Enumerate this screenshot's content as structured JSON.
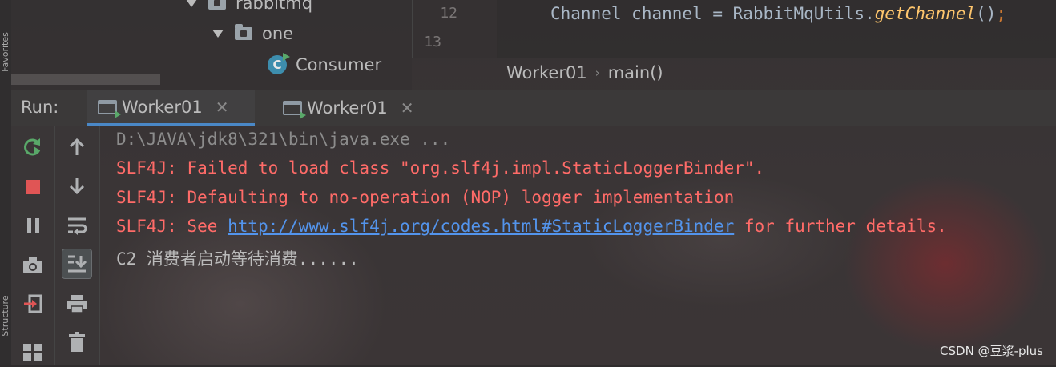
{
  "sidebar_edge": {
    "top_label": "Favorites",
    "bottom_label": "Structure"
  },
  "project_tree": {
    "items": [
      {
        "label": "rabbitmq",
        "type": "folder"
      },
      {
        "label": "one",
        "type": "folder"
      },
      {
        "label": "Consumer",
        "type": "class",
        "icon_letter": "C"
      }
    ]
  },
  "editor": {
    "line_numbers": [
      "12",
      "13"
    ],
    "code_line": {
      "type": "Channel",
      "var": "channel",
      "op": "=",
      "class": "RabbitMqUtils",
      "method": "getChannel",
      "suffix": "()",
      "semi": ";"
    },
    "breadcrumbs": [
      "Worker01",
      "main()"
    ]
  },
  "run_panel": {
    "label": "Run:",
    "tabs": [
      {
        "label": "Worker01",
        "active": true
      },
      {
        "label": "Worker01",
        "active": false
      }
    ]
  },
  "toolbar_left": [
    "rerun-icon",
    "stop-icon",
    "pause-icon",
    "camera-icon",
    "login-icon",
    "layout-icon"
  ],
  "toolbar_right": [
    "up-arrow-icon",
    "down-arrow-icon",
    "soft-wrap-icon",
    "scroll-to-end-icon",
    "print-icon",
    "trash-icon"
  ],
  "console": {
    "lines": [
      {
        "text": "D:\\JAVA\\jdk8\\321\\bin\\java.exe ...",
        "style": "gray"
      },
      {
        "text": "SLF4J: Failed to load class \"org.slf4j.impl.StaticLoggerBinder\".",
        "style": "red"
      },
      {
        "text": "SLF4J: Defaulting to no-operation (NOP) logger implementation",
        "style": "red"
      },
      {
        "prefix": "SLF4J: See ",
        "link": "http://www.slf4j.org/codes.html#StaticLoggerBinder",
        "suffix": " for further details.",
        "style": "red"
      },
      {
        "text": "C2 消费者启动等待消费......",
        "style": "plain"
      }
    ]
  },
  "watermark": "CSDN @豆浆-plus",
  "colors": {
    "error": "#ff6b68",
    "link": "#5394ec",
    "accent": "#4a88c7",
    "run_green": "#59a869",
    "stop_red": "#e05555"
  }
}
